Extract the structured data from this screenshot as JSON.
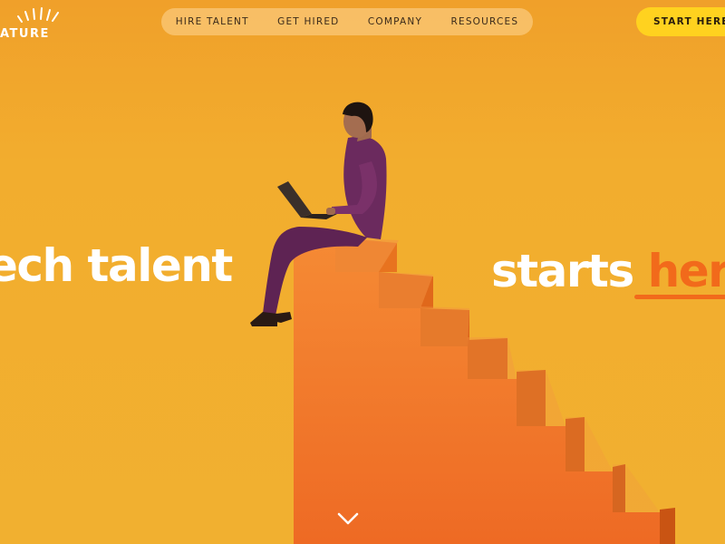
{
  "brand": {
    "logo_text": "ATURE"
  },
  "nav": {
    "items": [
      {
        "label": "HIRE TALENT"
      },
      {
        "label": "GET HIRED"
      },
      {
        "label": "COMPANY"
      },
      {
        "label": "RESOURCES"
      }
    ],
    "cta_label": "START HERE"
  },
  "hero": {
    "headline_left": "ech talent",
    "headline_right": "starts ",
    "headline_accent": "here",
    "scroll_icon": "chevron-down-icon"
  },
  "colors": {
    "background": "#f1ad2e",
    "accent": "#f26a1b",
    "cta": "#ffd21f",
    "stairs": "#f07a2c",
    "outfit": "#6b2a5e"
  }
}
